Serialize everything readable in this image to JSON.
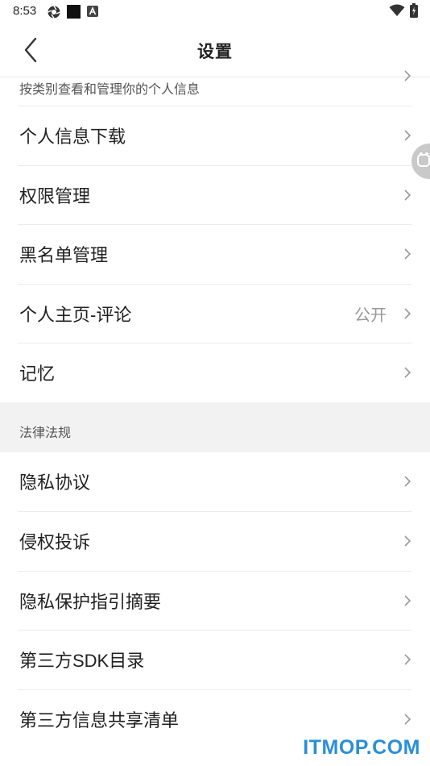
{
  "status_bar": {
    "time": "8:53"
  },
  "header": {
    "title": "设置"
  },
  "partial_item": {
    "label": "按类别查看和管理你的个人信息"
  },
  "privacy_items": [
    {
      "label": "个人信息下载",
      "value": ""
    },
    {
      "label": "权限管理",
      "value": ""
    },
    {
      "label": "黑名单管理",
      "value": ""
    },
    {
      "label": "个人主页-评论",
      "value": "公开"
    },
    {
      "label": "记忆",
      "value": ""
    }
  ],
  "legal_section": {
    "title": "法律法规",
    "items": [
      {
        "label": "隐私协议"
      },
      {
        "label": "侵权投诉"
      },
      {
        "label": "隐私保护指引摘要"
      },
      {
        "label": "第三方SDK目录"
      },
      {
        "label": "第三方信息共享清单"
      }
    ]
  },
  "watermark": "ITMOP.COM",
  "colors": {
    "accent_watermark": "#2a8fd8",
    "section_bg": "#f2f2f2",
    "value_text": "#999999"
  }
}
